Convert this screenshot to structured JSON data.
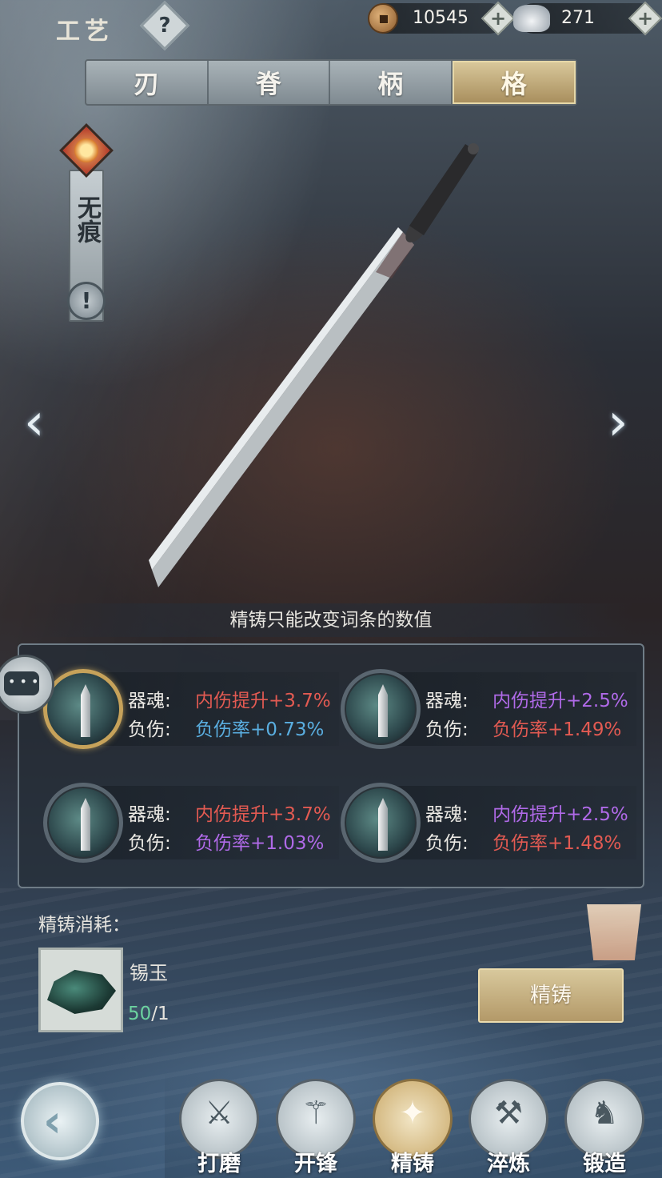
{
  "header": {
    "title": "工艺",
    "help_label": "?",
    "copper": {
      "icon": "copper-coin-icon",
      "value": "10545",
      "add_label": "+"
    },
    "silver": {
      "icon": "silver-ingot-icon",
      "value": "271",
      "add_label": "+"
    }
  },
  "tabs": [
    {
      "label": "刃",
      "active": false
    },
    {
      "label": "脊",
      "active": false
    },
    {
      "label": "柄",
      "active": false
    },
    {
      "label": "格",
      "active": true
    }
  ],
  "weapon": {
    "name": "无痕",
    "emblem_icon": "sun-emblem-icon",
    "info_label": "!"
  },
  "navigation": {
    "prev_glyph": "‹",
    "next_glyph": "›"
  },
  "hint": "精铸只能改变词条的数值",
  "slots": [
    {
      "selected": true,
      "line1": {
        "label": "器魂:",
        "value": "内伤提升+3.7%",
        "color": "#e25a52"
      },
      "line2": {
        "label": "负伤:",
        "value": "负伤率+0.73%",
        "color": "#5aaee0"
      }
    },
    {
      "selected": false,
      "line1": {
        "label": "器魂:",
        "value": "内伤提升+2.5%",
        "color": "#b06ae8"
      },
      "line2": {
        "label": "负伤:",
        "value": "负伤率+1.49%",
        "color": "#e25a52"
      }
    },
    {
      "selected": false,
      "line1": {
        "label": "器魂:",
        "value": "内伤提升+3.7%",
        "color": "#e25a52"
      },
      "line2": {
        "label": "负伤:",
        "value": "负伤率+1.03%",
        "color": "#b06ae8"
      }
    },
    {
      "selected": false,
      "line1": {
        "label": "器魂:",
        "value": "内伤提升+2.5%",
        "color": "#b06ae8"
      },
      "line2": {
        "label": "负伤:",
        "value": "负伤率+1.48%",
        "color": "#e25a52"
      }
    }
  ],
  "cost": {
    "label": "精铸消耗：",
    "item_name": "锡玉",
    "item_icon": "jade-ore-icon",
    "have": "50",
    "need": "/1"
  },
  "action_button": "精铸",
  "bottom_nav": [
    {
      "label": "打磨",
      "icon": "polish-icon",
      "glyph": "⚔",
      "active": false
    },
    {
      "label": "开锋",
      "icon": "sharpen-icon",
      "glyph": "⚚",
      "active": false
    },
    {
      "label": "精铸",
      "icon": "refine-icon",
      "glyph": "✦",
      "active": true
    },
    {
      "label": "淬炼",
      "icon": "temper-icon",
      "glyph": "⚒",
      "active": false
    },
    {
      "label": "锻造",
      "icon": "forge-icon",
      "glyph": "♞",
      "active": false
    }
  ],
  "colors": {
    "accent_gold": "#c9a868",
    "red_value": "#e25a52",
    "blue_value": "#5aaee0",
    "purple_value": "#b06ae8",
    "green_count": "#6cd2a0"
  }
}
